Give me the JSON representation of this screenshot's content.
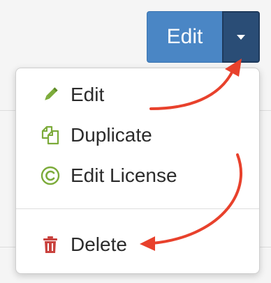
{
  "edit_button": {
    "label": "Edit",
    "toggle_icon": "caret-down-icon"
  },
  "dropdown": {
    "items": [
      {
        "label": "Edit",
        "icon": "pencil-icon"
      },
      {
        "label": "Duplicate",
        "icon": "duplicate-icon"
      },
      {
        "label": "Edit License",
        "icon": "copyright-icon"
      },
      {
        "label": "Delete",
        "icon": "trash-icon"
      }
    ]
  },
  "colors": {
    "primary_button": "#4a86c5",
    "toggle_button": "#2a4d76",
    "icon_green": "#7cab3a",
    "icon_red": "#c9423e",
    "annotation_arrow": "#e8412c"
  }
}
